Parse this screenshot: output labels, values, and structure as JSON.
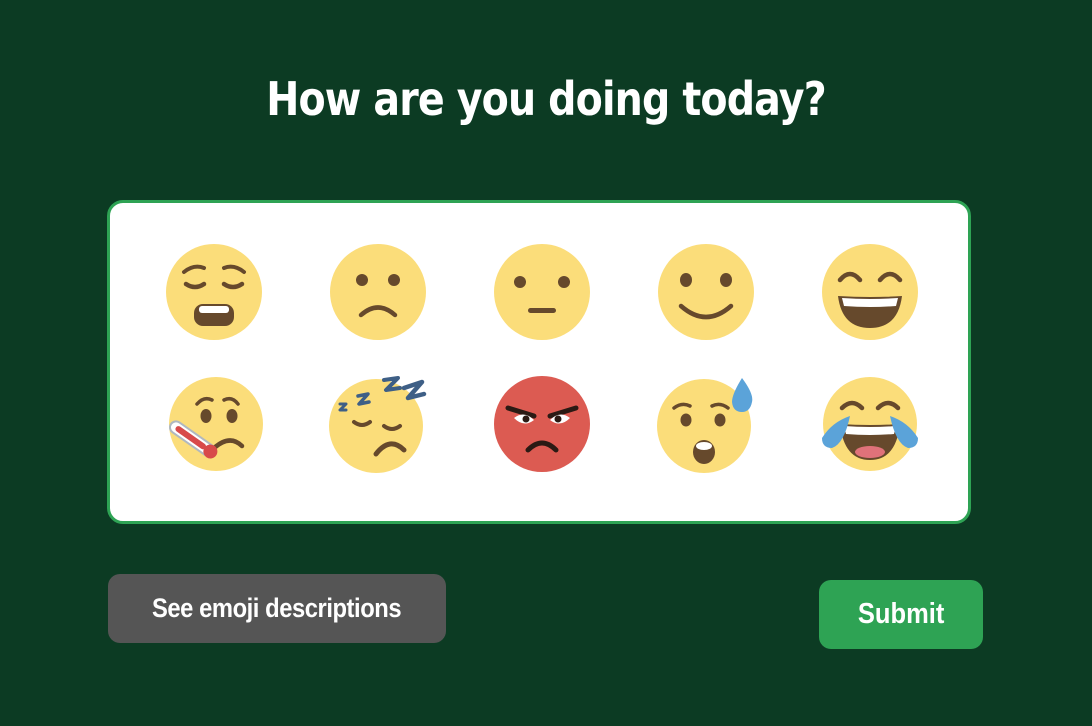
{
  "title": "How are you doing today?",
  "emojis": [
    {
      "name": "weary-face-icon"
    },
    {
      "name": "frowning-face-icon"
    },
    {
      "name": "neutral-face-icon"
    },
    {
      "name": "slightly-smiling-face-icon"
    },
    {
      "name": "grinning-squinting-face-icon"
    },
    {
      "name": "face-with-thermometer-icon"
    },
    {
      "name": "sleeping-face-icon"
    },
    {
      "name": "angry-face-icon"
    },
    {
      "name": "sad-sweat-face-icon"
    },
    {
      "name": "tears-of-joy-face-icon"
    }
  ],
  "buttons": {
    "descriptions_label": "See emoji descriptions",
    "submit_label": "Submit"
  },
  "colors": {
    "background": "#0c3b23",
    "panel": "#ffffff",
    "panel_border": "#2ea354",
    "emoji_yellow": "#fbdd7a",
    "emoji_features": "#66492c",
    "angry_red": "#dc5b52",
    "secondary_button": "#555555",
    "submit_button": "#2ea354"
  }
}
